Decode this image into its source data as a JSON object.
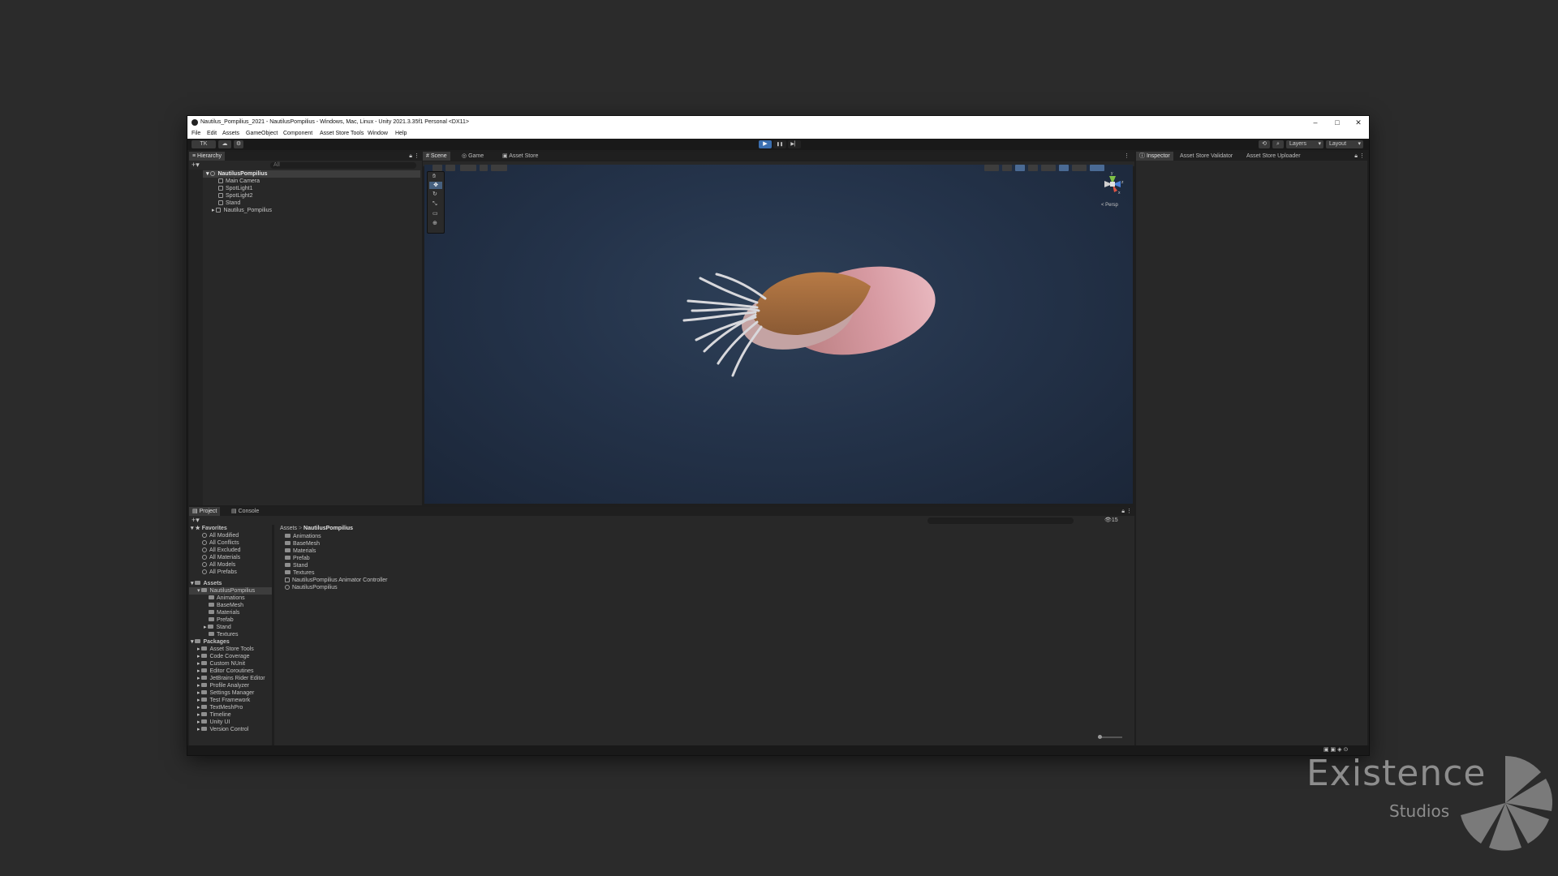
{
  "window": {
    "title": "Nautilus_Pompilius_2021 - NautilusPompilius - Windows, Mac, Linux - Unity 2021.3.35f1 Personal <DX11>",
    "minimize": "–",
    "maximize": "□",
    "close": "✕"
  },
  "menu": [
    "File",
    "Edit",
    "Assets",
    "GameObject",
    "Component",
    "Asset Store Tools",
    "Window",
    "Help"
  ],
  "toolbar": {
    "account": "TK",
    "play_icon": "▶",
    "pause_icon": "❚❚",
    "step_icon": "▶▏",
    "layers": "Layers",
    "layout": "Layout"
  },
  "hierarchy": {
    "tab": "Hierarchy",
    "search_placeholder": "All",
    "root": "NautilusPompilius",
    "items": [
      "Main Camera",
      "SpotLight1",
      "SpotLight2",
      "Stand",
      "Nautilus_Pompilius"
    ]
  },
  "scene": {
    "tabs": [
      "Scene",
      "Game",
      "Asset Store"
    ],
    "persp_label": "< Persp",
    "gizmo_axes": [
      "y",
      "z",
      "x"
    ]
  },
  "inspector": {
    "tabs": [
      "Inspector",
      "Asset Store Validator",
      "Asset Store Uploader"
    ]
  },
  "project": {
    "tabs": [
      "Project",
      "Console"
    ],
    "breadcrumb_root": "Assets",
    "breadcrumb_sep": ">",
    "breadcrumb_current": "NautilusPompilius",
    "hidden_count": "15",
    "favorites_label": "Favorites",
    "favorites": [
      "All Modified",
      "All Conflicts",
      "All Excluded",
      "All Materials",
      "All Models",
      "All Prefabs"
    ],
    "assets_label": "Assets",
    "assets_root": "NautilusPompilius",
    "asset_children": [
      "Animations",
      "BaseMesh",
      "Materials",
      "Prefab",
      "Stand",
      "Textures"
    ],
    "packages_label": "Packages",
    "packages": [
      "Asset Store Tools",
      "Code Coverage",
      "Custom NUnit",
      "Editor Coroutines",
      "JetBrains Rider Editor",
      "Profile Analyzer",
      "Settings Manager",
      "Test Framework",
      "TextMeshPro",
      "Timeline",
      "Unity UI",
      "Version Control"
    ],
    "files": [
      "Animations",
      "BaseMesh",
      "Materials",
      "Prefab",
      "Stand",
      "Textures",
      "NautilusPompilius Animator Controller",
      "NautilusPompilius"
    ]
  },
  "watermark": {
    "brand": "Existence",
    "sub": "Studios"
  }
}
